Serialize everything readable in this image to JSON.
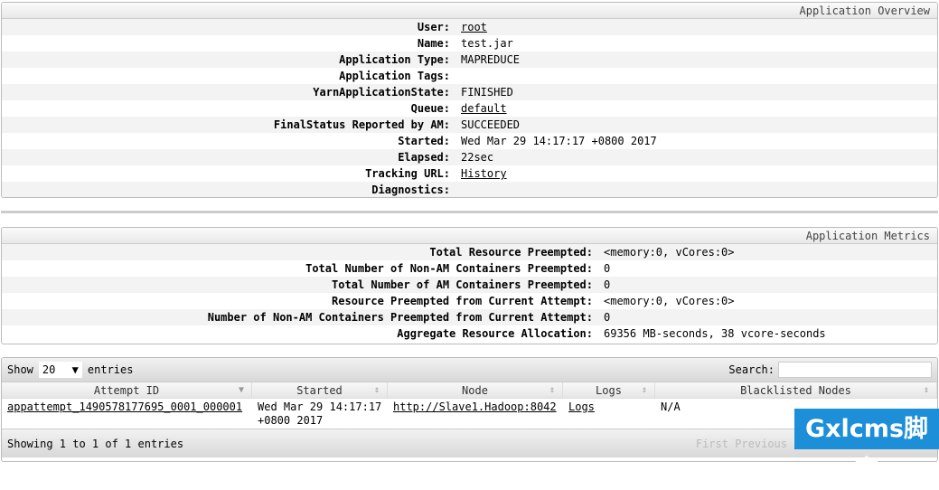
{
  "overview": {
    "title": "Application Overview",
    "rows": [
      {
        "label": "User:",
        "value": "root",
        "link": true
      },
      {
        "label": "Name:",
        "value": "test.jar"
      },
      {
        "label": "Application Type:",
        "value": "MAPREDUCE"
      },
      {
        "label": "Application Tags:",
        "value": ""
      },
      {
        "label": "YarnApplicationState:",
        "value": "FINISHED"
      },
      {
        "label": "Queue:",
        "value": "default",
        "link": true
      },
      {
        "label": "FinalStatus Reported by AM:",
        "value": "SUCCEEDED"
      },
      {
        "label": "Started:",
        "value": "Wed Mar 29 14:17:17 +0800 2017"
      },
      {
        "label": "Elapsed:",
        "value": "22sec"
      },
      {
        "label": "Tracking URL:",
        "value": "History",
        "link": true
      },
      {
        "label": "Diagnostics:",
        "value": ""
      }
    ]
  },
  "metrics": {
    "title": "Application Metrics",
    "rows": [
      {
        "label": "Total Resource Preempted:",
        "value": "<memory:0, vCores:0>"
      },
      {
        "label": "Total Number of Non-AM Containers Preempted:",
        "value": "0"
      },
      {
        "label": "Total Number of AM Containers Preempted:",
        "value": "0"
      },
      {
        "label": "Resource Preempted from Current Attempt:",
        "value": "<memory:0, vCores:0>"
      },
      {
        "label": "Number of Non-AM Containers Preempted from Current Attempt:",
        "value": "0"
      },
      {
        "label": "Aggregate Resource Allocation:",
        "value": "69356 MB-seconds, 38 vcore-seconds"
      }
    ]
  },
  "table": {
    "show": "Show",
    "page_size": "20",
    "entries": "entries",
    "search_label": "Search:",
    "columns": [
      "Attempt ID",
      "Started",
      "Node",
      "Logs",
      "Blacklisted Nodes"
    ],
    "rows": [
      [
        "appattempt_1490578177695_0001_000001",
        "Wed Mar 29 14:17:17 +0800 2017",
        "http://Slave1.Hadoop:8042",
        "Logs",
        "N/A"
      ]
    ],
    "info": "Showing 1 to 1 of 1 entries",
    "first": "First",
    "prev": "Previous"
  },
  "watermark": "Gxlcms脚本"
}
